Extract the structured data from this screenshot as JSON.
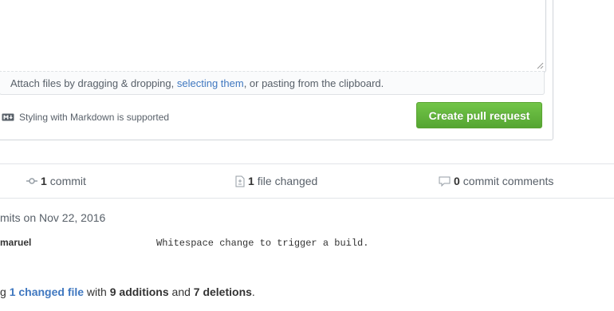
{
  "dropzone": {
    "prefix": "Attach files by dragging & dropping, ",
    "link": "selecting them",
    "suffix": ", or pasting from the clipboard."
  },
  "markdown": {
    "label": "Styling with Markdown is supported",
    "icon": "markdown-icon"
  },
  "create_button": {
    "label": "Create pull request",
    "color": "#55a532"
  },
  "summary": {
    "commits": {
      "count": "1",
      "label": "commit",
      "icon": "commit-icon"
    },
    "files": {
      "count": "1",
      "label": "file changed",
      "icon": "file-diff-icon"
    },
    "comments": {
      "count": "0",
      "label": "commit comments",
      "icon": "comment-icon"
    }
  },
  "commits": {
    "date_heading": "mits on Nov 22, 2016",
    "items": [
      {
        "author": "maruel",
        "message": "Whitespace change to trigger a build."
      }
    ]
  },
  "diff": {
    "prefix": "g ",
    "files_link": "1 changed file",
    "mid1": " with ",
    "additions": "9 additions",
    "mid2": " and ",
    "deletions": "7 deletions",
    "suffix": "."
  },
  "colors": {
    "link": "#4078c0",
    "muted": "#586069",
    "border": "#d1d5da"
  }
}
